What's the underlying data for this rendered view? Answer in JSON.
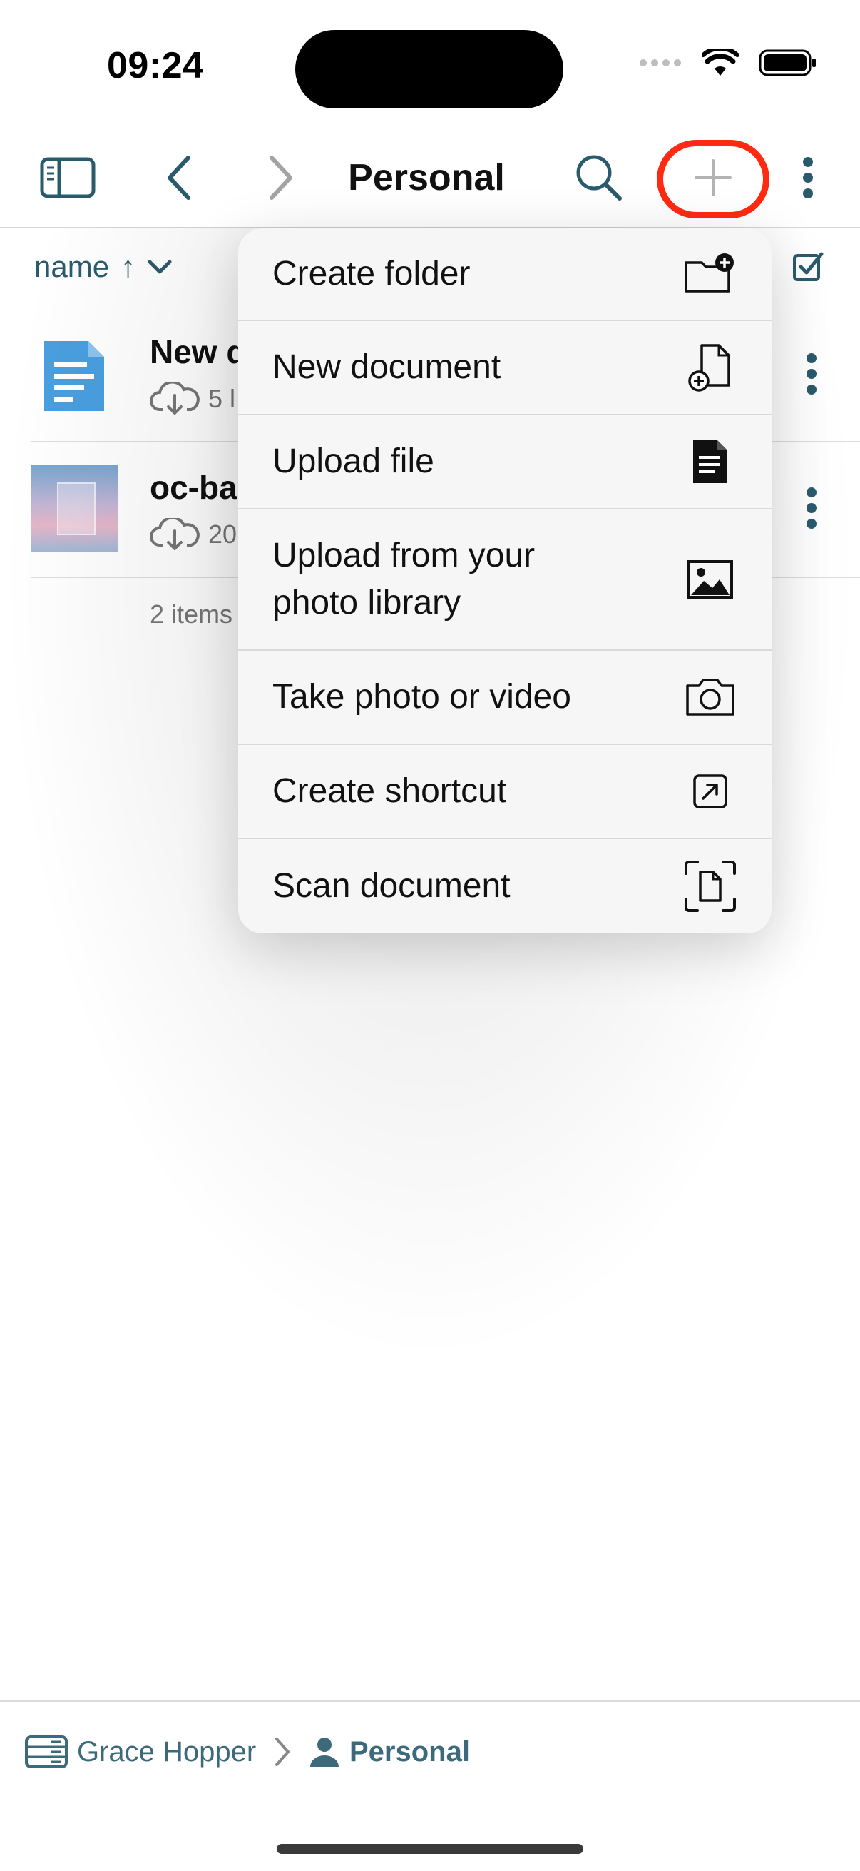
{
  "status_bar": {
    "time": "09:24"
  },
  "navbar": {
    "title": "Personal"
  },
  "sort": {
    "label": "name",
    "arrow": "↑"
  },
  "files": [
    {
      "name": "New d",
      "meta": "5 l"
    },
    {
      "name": "oc-ba",
      "meta": "20"
    }
  ],
  "footer": {
    "count": "2 items"
  },
  "menu": {
    "items": [
      {
        "label": "Create folder",
        "icon": "folder-plus-icon"
      },
      {
        "label": "New document",
        "icon": "document-plus-icon"
      },
      {
        "label": "Upload file",
        "icon": "file-text-icon"
      },
      {
        "label": "Upload from your photo library",
        "icon": "photo-icon"
      },
      {
        "label": "Take photo or video",
        "icon": "camera-icon"
      },
      {
        "label": "Create shortcut",
        "icon": "shortcut-arrow-icon"
      },
      {
        "label": "Scan document",
        "icon": "scan-document-icon"
      }
    ]
  },
  "breadcrumb": {
    "server": "Grace Hopper",
    "space": "Personal"
  },
  "colors": {
    "accent": "#2a5b6c",
    "highlight": "#ff2a12",
    "doc_blue": "#4a9fe0"
  }
}
